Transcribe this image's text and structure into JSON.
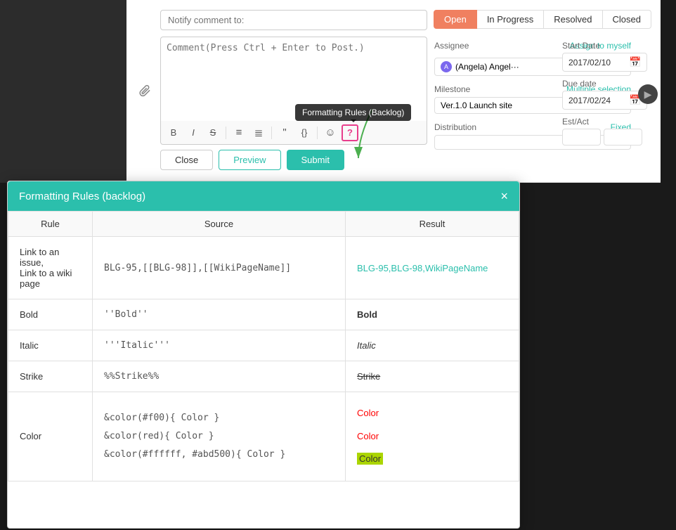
{
  "status_buttons": {
    "open": "Open",
    "in_progress": "In Progress",
    "resolved": "Resolved",
    "closed": "Closed"
  },
  "notify": {
    "placeholder": "Notify comment to:"
  },
  "comment": {
    "placeholder": "Comment(Press Ctrl + Enter to Post.)"
  },
  "toolbar": {
    "bold": "B",
    "italic": "I",
    "strike": "S",
    "ul": "•",
    "ol": "1.",
    "quote": "❞",
    "code": "{}",
    "emoji": "☺",
    "help": "?"
  },
  "buttons": {
    "close": "Close",
    "preview": "Preview",
    "submit": "Submit"
  },
  "assignee": {
    "label": "Assignee",
    "link": "Assign to myself",
    "value": "(Angela) Angel···"
  },
  "milestone": {
    "label": "Milestone",
    "link": "Multiple selection",
    "value": "Ver.1.0 Launch site"
  },
  "distribution": {
    "label": "Distribution",
    "link": "Fixed"
  },
  "start_date": {
    "label": "Start Date",
    "value": "2017/02/10"
  },
  "due_date": {
    "label": "Due date",
    "value": "2017/02/24"
  },
  "est_act": {
    "label": "Est/Act"
  },
  "tooltip": {
    "text": "Formatting Rules (Backlog)"
  },
  "dialog": {
    "title": "Formatting Rules (backlog)",
    "close_btn": "×",
    "table": {
      "headers": [
        "Rule",
        "Source",
        "Result"
      ],
      "rows": [
        {
          "rule": "Link to an issue,\nLink to a wiki page",
          "source": "BLG-95,[[BLG-98]],[[WikiPageName]]",
          "result_type": "links",
          "result": "BLG-95,BLG-98,WikiPageName"
        },
        {
          "rule": "Bold",
          "source": "''Bold''",
          "result_type": "bold",
          "result": "Bold"
        },
        {
          "rule": "Italic",
          "source": "'''Italic'''",
          "result_type": "italic",
          "result": "Italic"
        },
        {
          "rule": "Strike",
          "source": "%%Strike%%",
          "result_type": "strike",
          "result": "Strike"
        },
        {
          "rule": "Color",
          "source": "&color(#f00){ Color }\n&color(red){ Color }\n&color(#ffffff, #abd500){ Color }",
          "result_type": "color",
          "results": [
            {
              "text": "Color",
              "style": "red"
            },
            {
              "text": "Color",
              "style": "named"
            },
            {
              "text": "Color",
              "style": "highlight"
            }
          ]
        }
      ]
    }
  }
}
